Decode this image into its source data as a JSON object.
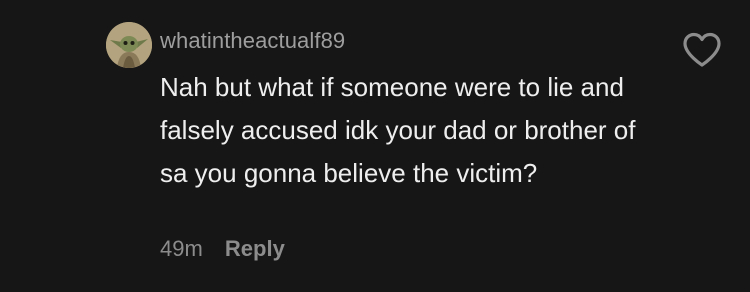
{
  "comment": {
    "username": "whatintheactualf89",
    "text": "Nah but what if someone were to lie and falsely accused idk your dad or brother of sa you gonna believe the victim?",
    "timestamp": "49m",
    "reply_label": "Reply",
    "avatar_icon": "baby-yoda-avatar",
    "like_icon": "heart-outline-icon"
  },
  "colors": {
    "background": "#161616",
    "username": "#9e9e9e",
    "text": "#eeeeee",
    "meta": "#8c8c8c"
  }
}
